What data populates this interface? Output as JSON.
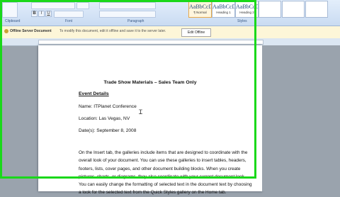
{
  "ribbon": {
    "group_clipboard": "Clipboard",
    "group_font": "Font",
    "group_paragraph": "Paragraph",
    "group_styles": "Styles",
    "styles": [
      {
        "sample": "AaBbCcD",
        "name": "¶ Normal"
      },
      {
        "sample": "AaBbCcD",
        "name": "Heading 1"
      },
      {
        "sample": "AaBbCcD",
        "name": "Heading 2"
      }
    ]
  },
  "message_bar": {
    "title": "Offline Server Document",
    "text": "To modify this document, edit it offline and save it to the server later.",
    "button": "Edit Offline"
  },
  "document": {
    "title": "Trade Show Materials – Sales Team Only",
    "section_heading": "Event Details",
    "name_line": "Name:  ITPlanet Conference",
    "location_line": "Location:  Las Vegas, NV",
    "dates_line": "Date(s):  September 8, 2008",
    "body_lines": [
      "On the Insert tab, the galleries include items that are designed to coordinate with the",
      "overall look of your document. You can use these galleries to insert tables, headers,",
      "footers, lists, cover pages, and other document building blocks. When you create",
      "pictures, charts, or diagrams, they also coordinate with your current document look.",
      "You can easily change the formatting of selected text in the document text by choosing",
      "a look for the selected text from the Quick Styles gallery on the Home tab."
    ]
  },
  "colors": {
    "highlight": "#1ad81a",
    "ribbon": "#c9dbf2",
    "message_bar": "#fdf6d8"
  }
}
